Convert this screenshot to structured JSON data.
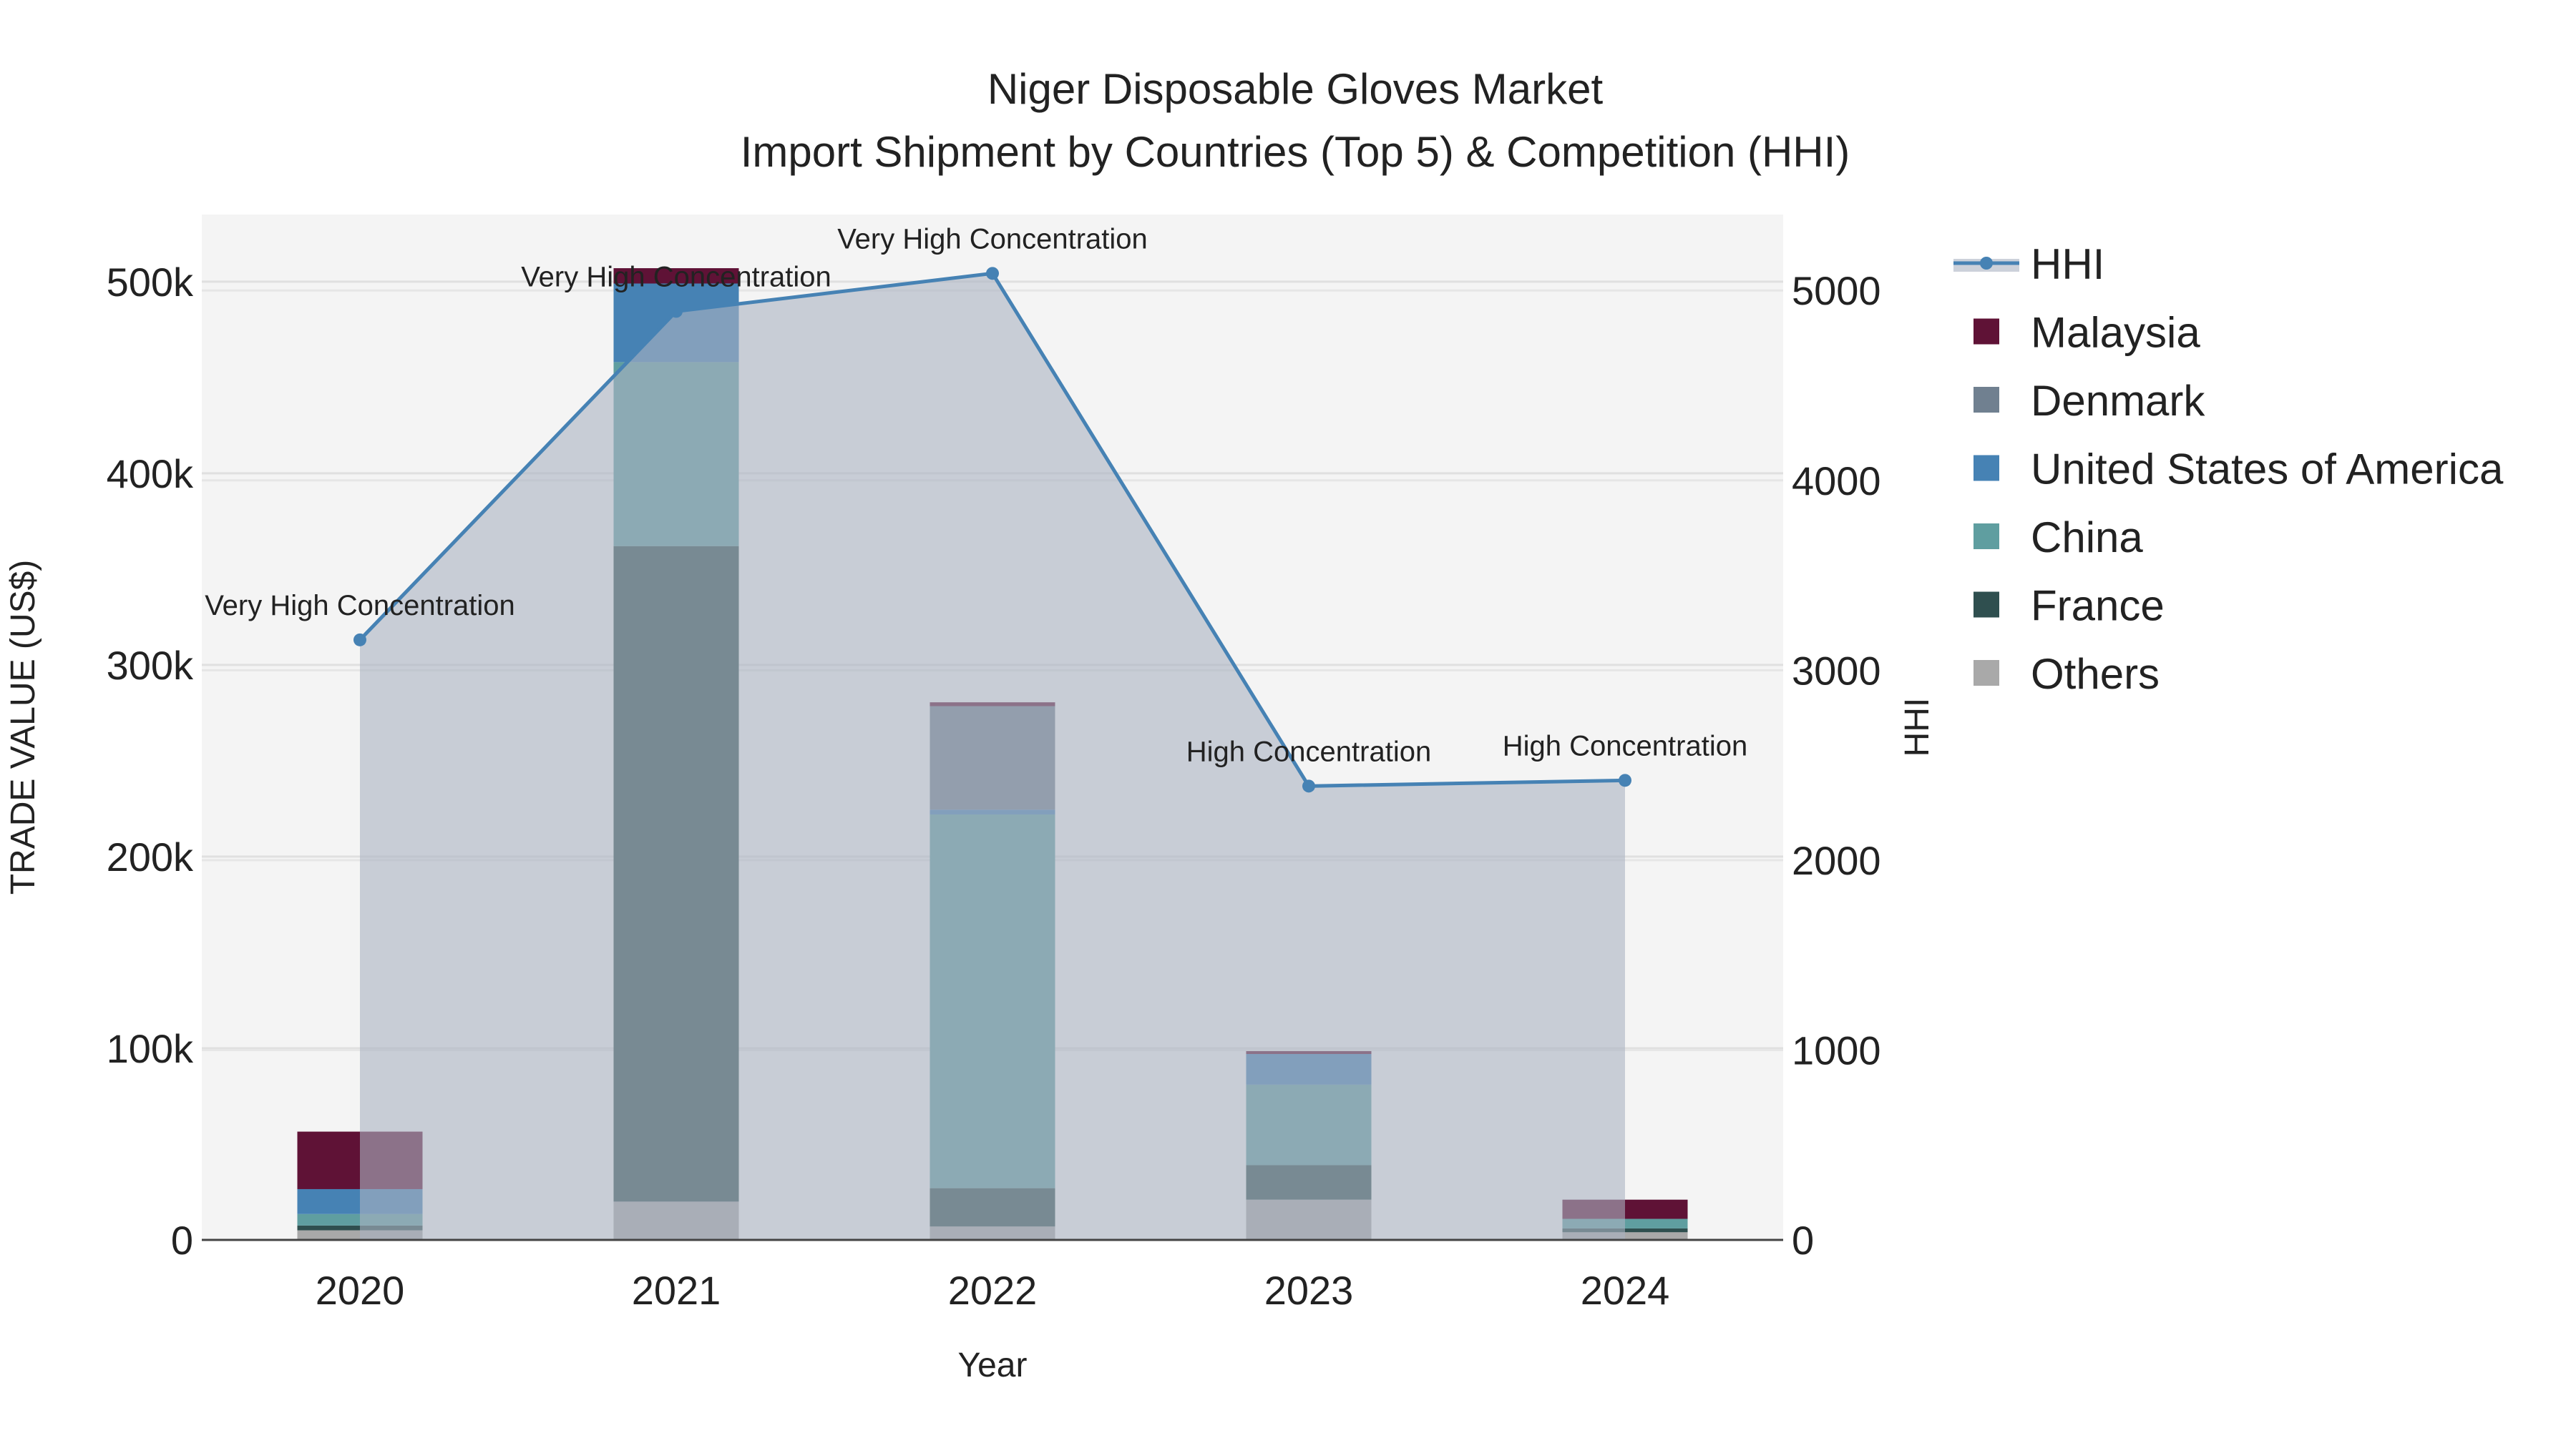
{
  "chart_data": {
    "type": "bar",
    "title_line1": "Niger Disposable Gloves Market",
    "title_line2": "Import Shipment by Countries (Top 5) & Competition (HHI)",
    "xlabel": "Year",
    "ylabel": "TRADE VALUE (US$)",
    "y2label": "HHI",
    "categories": [
      "2020",
      "2021",
      "2022",
      "2023",
      "2024"
    ],
    "ylim": [
      0,
      535000
    ],
    "y2lim": [
      0,
      5400
    ],
    "yticks": [
      {
        "v": 0,
        "label": "0"
      },
      {
        "v": 100000,
        "label": "100k"
      },
      {
        "v": 200000,
        "label": "200k"
      },
      {
        "v": 300000,
        "label": "300k"
      },
      {
        "v": 400000,
        "label": "400k"
      },
      {
        "v": 500000,
        "label": "500k"
      }
    ],
    "y2ticks": [
      {
        "v": 0,
        "label": "0"
      },
      {
        "v": 1000,
        "label": "1000"
      },
      {
        "v": 2000,
        "label": "2000"
      },
      {
        "v": 3000,
        "label": "3000"
      },
      {
        "v": 4000,
        "label": "4000"
      },
      {
        "v": 5000,
        "label": "5000"
      }
    ],
    "series": [
      {
        "name": "Others",
        "color": "#a9a9a9",
        "values": [
          5000,
          20000,
          7000,
          21000,
          4000
        ]
      },
      {
        "name": "France",
        "color": "#2f4f4f",
        "values": [
          2500,
          342000,
          20000,
          18000,
          2000
        ]
      },
      {
        "name": "China",
        "color": "#5f9ea0",
        "values": [
          6000,
          96000,
          195000,
          42000,
          5000
        ]
      },
      {
        "name": "United States of America",
        "color": "#4682b4",
        "values": [
          13000,
          41000,
          2500,
          16000,
          0
        ]
      },
      {
        "name": "Denmark",
        "color": "#708090",
        "values": [
          0,
          0,
          54000,
          0,
          0
        ]
      },
      {
        "name": "Malaysia",
        "color": "#5f1236",
        "values": [
          30000,
          8000,
          2000,
          1500,
          10000
        ]
      }
    ],
    "hhi": {
      "name": "HHI",
      "color": "#4682b4",
      "values": [
        3160,
        4890,
        5090,
        2390,
        2420
      ],
      "annotations": [
        "Very High Concentration",
        "Very High Concentration",
        "Very High Concentration",
        "High Concentration",
        "High Concentration"
      ]
    },
    "legend": {
      "placement": "right",
      "order": [
        "HHI",
        "Malaysia",
        "Denmark",
        "United States of America",
        "China",
        "France",
        "Others"
      ]
    },
    "grid": true
  }
}
